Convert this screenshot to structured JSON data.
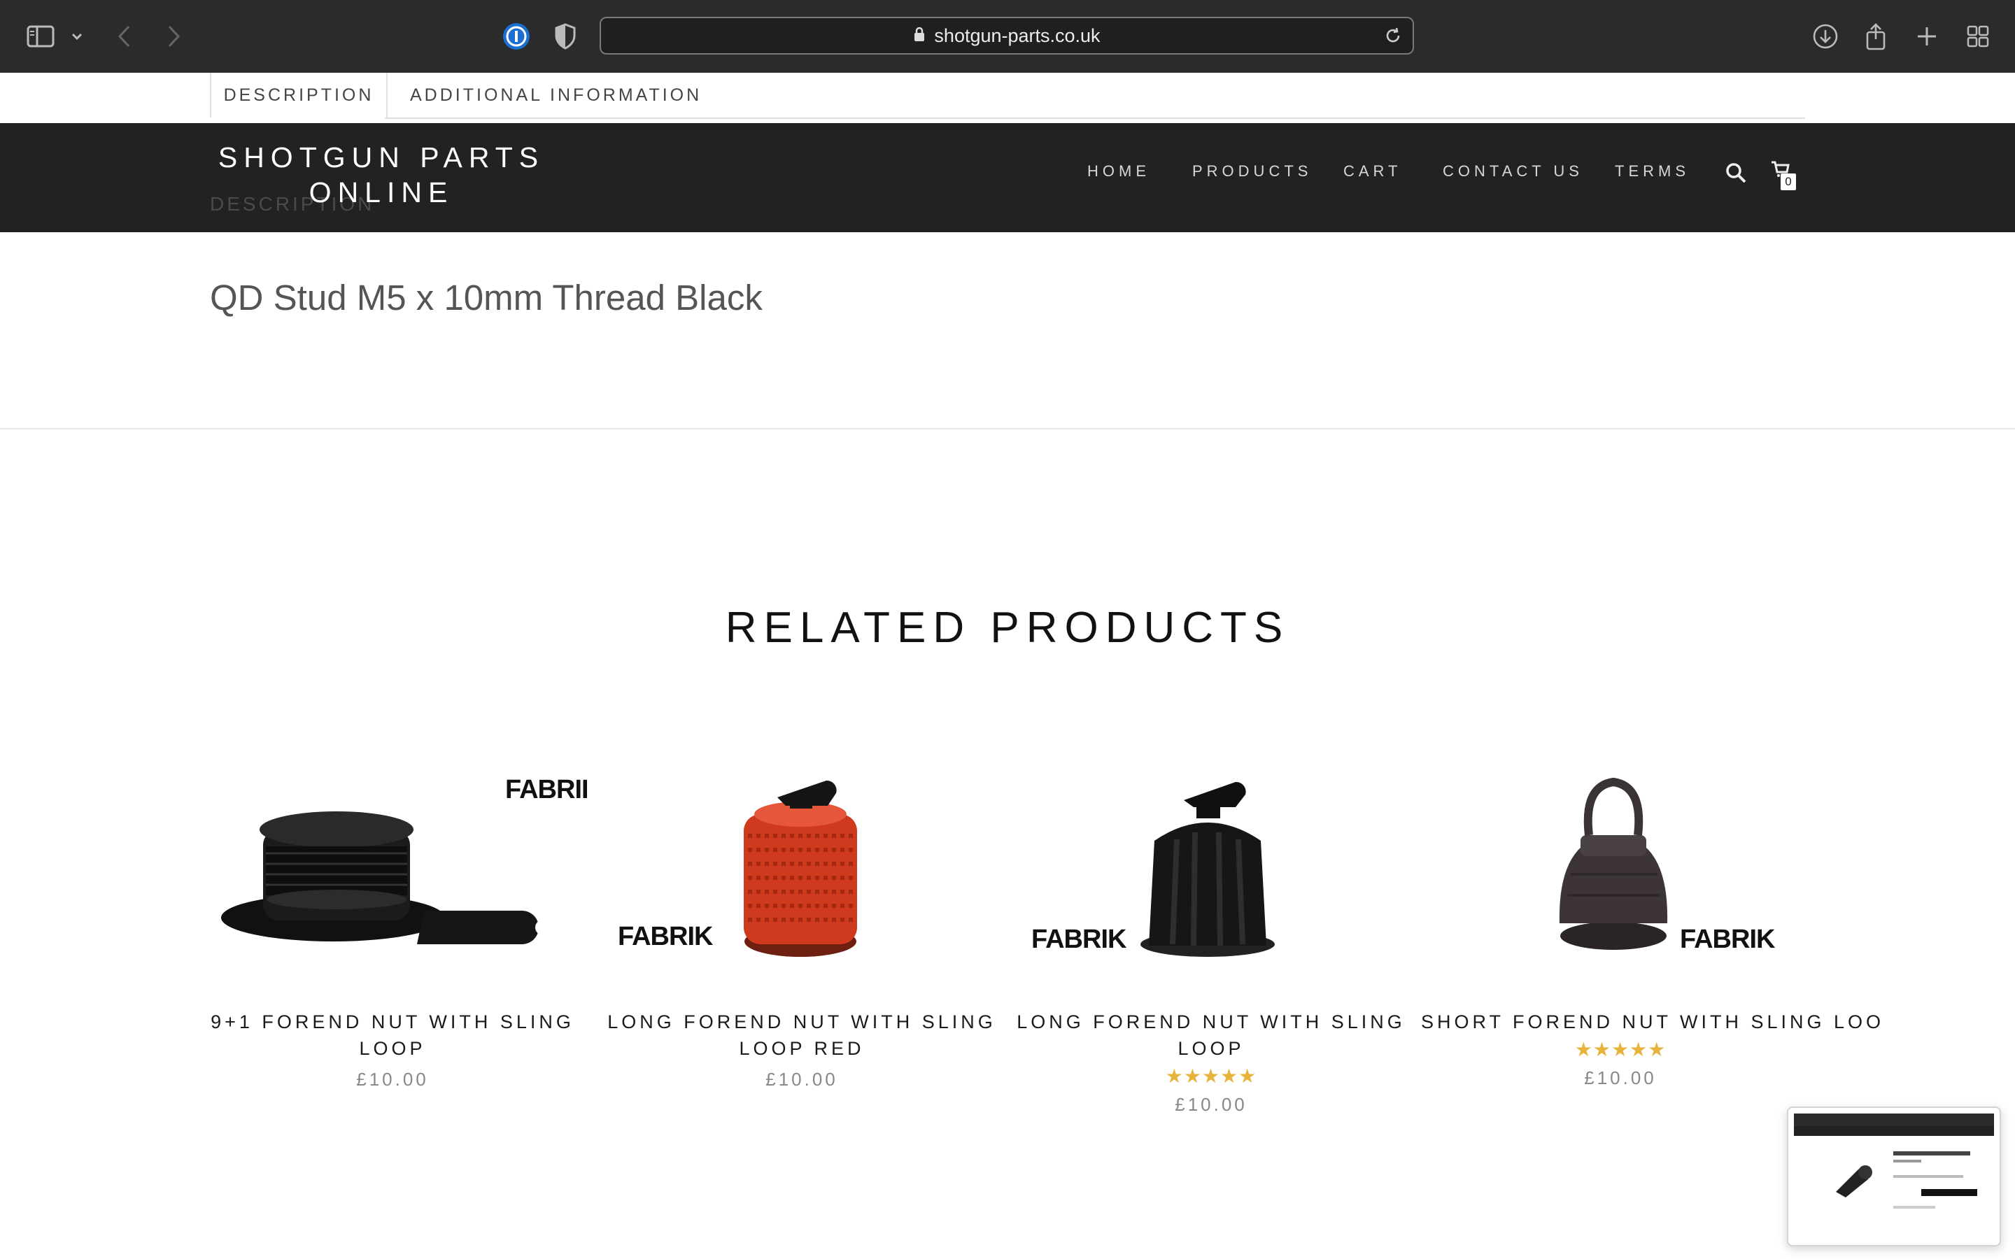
{
  "browser": {
    "url": "shotgun-parts.co.uk"
  },
  "tabs": {
    "description": "DESCRIPTION",
    "additional_information": "ADDITIONAL INFORMATION"
  },
  "header": {
    "site_title_line1": "SHOTGUN PARTS",
    "site_title_line2": "ONLINE",
    "ghost_text": "DESCRIPTION",
    "nav": [
      "HOME",
      "PRODUCTS",
      "CART",
      "CONTACT US",
      "TERMS"
    ],
    "cart_count": "0"
  },
  "content": {
    "product_description": "QD Stud M5 x 10mm Thread Black",
    "related_title": "RELATED PRODUCTS"
  },
  "related_products": [
    {
      "name": "9+1 FOREND NUT WITH SLING LOOP",
      "price": "£10.00",
      "rating": "",
      "brand_text": "FABRII"
    },
    {
      "name": "LONG FOREND NUT WITH SLING LOOP RED",
      "price": "£10.00",
      "rating": "",
      "brand_text": "FABRIK"
    },
    {
      "name": "LONG FOREND NUT WITH SLING LOOP",
      "price": "£10.00",
      "rating": "★★★★★",
      "brand_text": "FABRIK"
    },
    {
      "name": "SHORT FOREND NUT WITH SLING LOO",
      "price": "£10.00",
      "rating": "★★★★★",
      "brand_text": "FABRIK"
    }
  ],
  "colors": {
    "chrome_bg": "#2b2b2b",
    "header_bg": "#222222",
    "star": "#e8b33a",
    "product_red": "#d43a1f"
  }
}
